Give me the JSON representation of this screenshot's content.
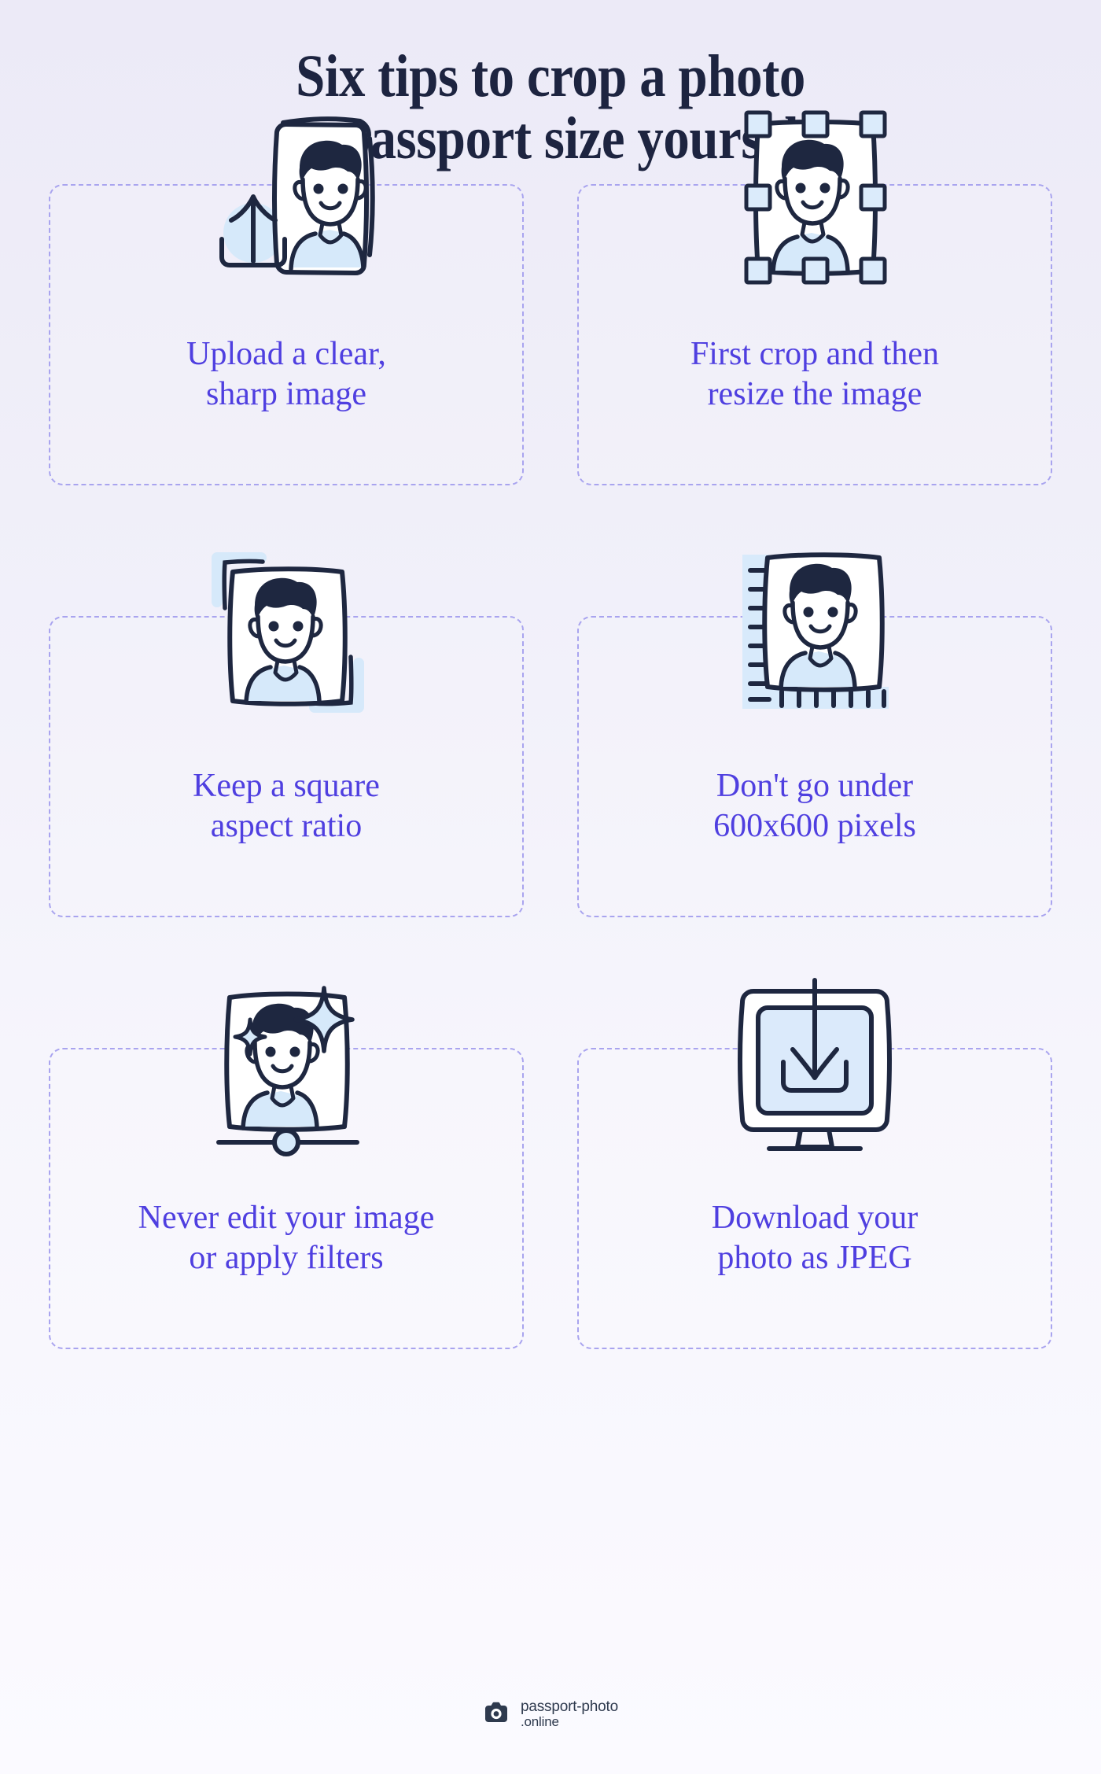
{
  "title": {
    "line1": "Six tips to crop a photo",
    "line2": "to passport size yourself"
  },
  "colors": {
    "title": "#1d2440",
    "body_text": "#4f3fe0",
    "card_border": "#a9a4ef",
    "ink": "#1e2740",
    "accent_blue": "#d6e9fa",
    "background_top": "#eceaf7",
    "background_bottom": "#fbfaff"
  },
  "cards": [
    {
      "id": "upload-clear-sharp-image",
      "icon": "upload-photo-icon",
      "text": "Upload a clear,\nsharp image"
    },
    {
      "id": "crop-then-resize",
      "icon": "crop-handles-photo-icon",
      "text": "First crop and then\nresize the image"
    },
    {
      "id": "square-aspect-ratio",
      "icon": "square-aspect-ratio-photo-icon",
      "text": "Keep a square\naspect ratio"
    },
    {
      "id": "minimum-pixel-size",
      "icon": "ruler-photo-icon",
      "text": "Don't go under\n600x600 pixels"
    },
    {
      "id": "no-edits-or-filters",
      "icon": "sparkle-filter-photo-icon",
      "text": "Never edit your image\nor apply filters"
    },
    {
      "id": "download-as-jpeg",
      "icon": "monitor-download-icon",
      "text": "Download your\nphoto as JPEG"
    }
  ],
  "footer": {
    "logo_icon": "camera-icon",
    "brand_line1": "passport-photo",
    "brand_line2": ".online"
  }
}
